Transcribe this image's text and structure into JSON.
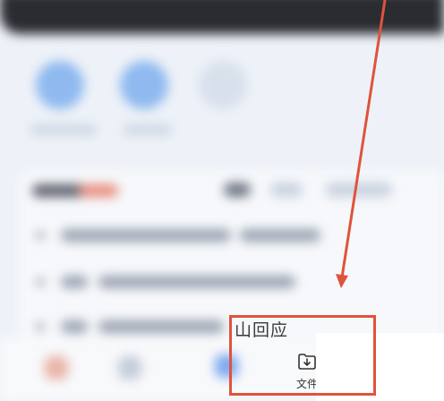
{
  "bottom_bar": {
    "file_button": {
      "label": "文件",
      "icon": "folder-download-icon"
    }
  },
  "overlay_text": "山回应",
  "annotation": {
    "highlight_color": "#e0533c",
    "arrow_color": "#e0533c"
  },
  "colors": {
    "header": "#2a2c31",
    "accent_blue": "#8fb9ef",
    "background": "#eef2f8"
  }
}
